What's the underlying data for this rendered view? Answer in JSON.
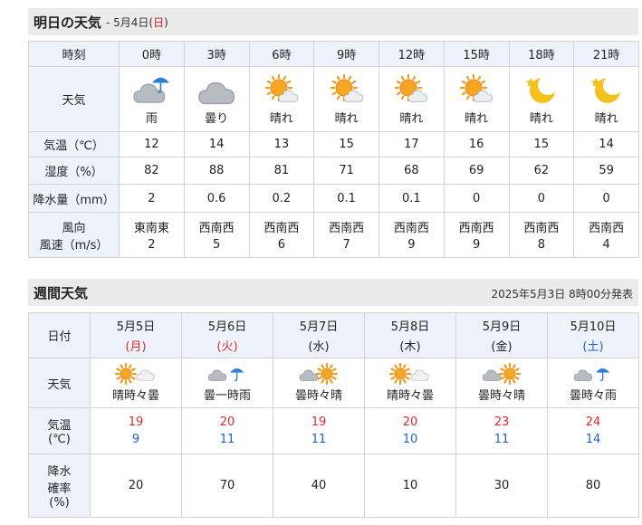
{
  "tomorrow": {
    "title": "明日の天気",
    "date_prefix": "- 5月4日(",
    "date_dow": "日",
    "date_suffix": ")",
    "row_labels": {
      "time": "時刻",
      "weather": "天気",
      "temp": "気温（℃）",
      "humidity": "湿度（%）",
      "precip": "降水量（mm）",
      "wind_dir": "風向",
      "wind_speed": "風速（m/s）"
    },
    "hours": [
      {
        "time": "0時",
        "icon": "rain-cloud-icon",
        "weather": "雨",
        "temp": "12",
        "humidity": "82",
        "precip": "2",
        "wind_dir": "東南東",
        "wind_speed": "2"
      },
      {
        "time": "3時",
        "icon": "cloud-icon",
        "weather": "曇り",
        "temp": "14",
        "humidity": "88",
        "precip": "0.6",
        "wind_dir": "西南西",
        "wind_speed": "5"
      },
      {
        "time": "6時",
        "icon": "sun-cloud-icon",
        "weather": "晴れ",
        "temp": "13",
        "humidity": "81",
        "precip": "0.2",
        "wind_dir": "西南西",
        "wind_speed": "6"
      },
      {
        "time": "9時",
        "icon": "sun-cloud-icon",
        "weather": "晴れ",
        "temp": "15",
        "humidity": "71",
        "precip": "0.1",
        "wind_dir": "西南西",
        "wind_speed": "7"
      },
      {
        "time": "12時",
        "icon": "sun-cloud-icon",
        "weather": "晴れ",
        "temp": "17",
        "humidity": "68",
        "precip": "0.1",
        "wind_dir": "西南西",
        "wind_speed": "9"
      },
      {
        "time": "15時",
        "icon": "sun-cloud-icon",
        "weather": "晴れ",
        "temp": "16",
        "humidity": "69",
        "precip": "0",
        "wind_dir": "西南西",
        "wind_speed": "9"
      },
      {
        "time": "18時",
        "icon": "moon-star-icon",
        "weather": "晴れ",
        "temp": "15",
        "humidity": "62",
        "precip": "0",
        "wind_dir": "西南西",
        "wind_speed": "8"
      },
      {
        "time": "21時",
        "icon": "moon-star-icon",
        "weather": "晴れ",
        "temp": "14",
        "humidity": "59",
        "precip": "0",
        "wind_dir": "西南西",
        "wind_speed": "4"
      }
    ]
  },
  "weekly": {
    "title": "週間天気",
    "issued": "2025年5月3日 8時00分発表",
    "row_labels": {
      "date": "日付",
      "weather": "天気",
      "temp_1": "気温",
      "temp_2": "(℃)",
      "rain_1": "降水",
      "rain_2": "確率",
      "rain_3": "(%)"
    },
    "days": [
      {
        "date": "5月5日",
        "dow": "(月)",
        "dow_color": "red",
        "icon": "sun-then-cloud-icon",
        "weather": "晴時々曇",
        "high": "19",
        "low": "9",
        "rain": "20"
      },
      {
        "date": "5月6日",
        "dow": "(火)",
        "dow_color": "red",
        "icon": "cloud-then-rain-icon",
        "weather": "曇一時雨",
        "high": "20",
        "low": "11",
        "rain": "70"
      },
      {
        "date": "5月7日",
        "dow": "(水)",
        "dow_color": "black",
        "icon": "cloud-then-sun-icon",
        "weather": "曇時々晴",
        "high": "19",
        "low": "11",
        "rain": "40"
      },
      {
        "date": "5月8日",
        "dow": "(木)",
        "dow_color": "black",
        "icon": "sun-then-cloud-icon",
        "weather": "晴時々曇",
        "high": "20",
        "low": "10",
        "rain": "10"
      },
      {
        "date": "5月9日",
        "dow": "(金)",
        "dow_color": "black",
        "icon": "cloud-then-sun-icon",
        "weather": "曇時々晴",
        "high": "23",
        "low": "11",
        "rain": "30"
      },
      {
        "date": "5月10日",
        "dow": "(土)",
        "dow_color": "blue",
        "icon": "cloud-then-rain-icon",
        "weather": "曇時々雨",
        "high": "24",
        "low": "14",
        "rain": "80"
      }
    ]
  }
}
